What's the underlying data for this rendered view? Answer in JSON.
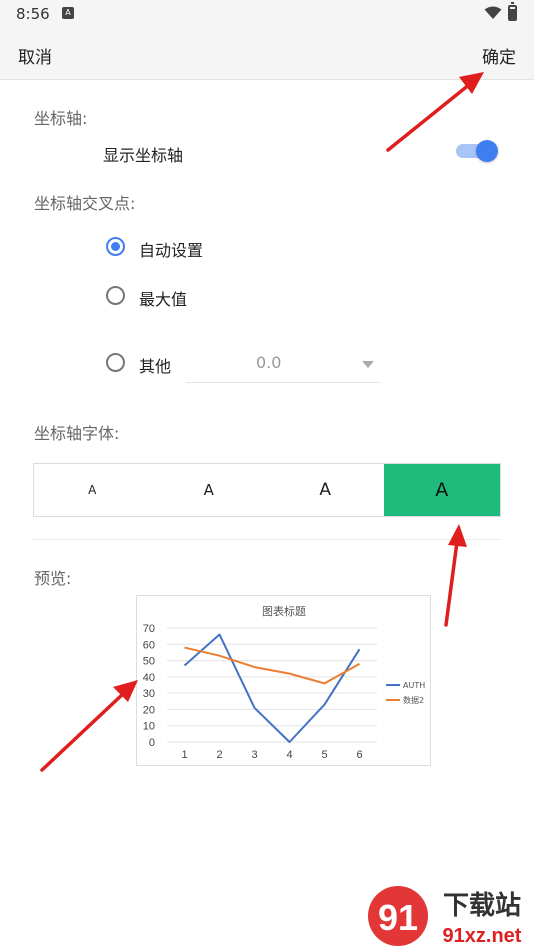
{
  "status_bar": {
    "time": "8:56",
    "notification_glyph": "A"
  },
  "top_bar": {
    "cancel_label": "取消",
    "confirm_label": "确定"
  },
  "axis": {
    "section_label": "坐标轴:",
    "show_axis_label": "显示坐标轴",
    "show_axis_on": true
  },
  "crossing": {
    "section_label": "坐标轴交叉点:",
    "options": [
      "自动设置",
      "最大值",
      "其他"
    ],
    "selected_index": 0,
    "other_value": "0.0"
  },
  "font": {
    "section_label": "坐标轴字体:",
    "options": [
      "A",
      "A",
      "A",
      "A"
    ],
    "selected_index": 3
  },
  "preview": {
    "section_label": "预览:"
  },
  "chart_data": {
    "type": "line",
    "title": "图表标题",
    "categories": [
      "1",
      "2",
      "3",
      "4",
      "5",
      "6"
    ],
    "ylim": [
      0,
      70
    ],
    "yticks": [
      "0",
      "10",
      "20",
      "30",
      "40",
      "50",
      "60",
      "70"
    ],
    "grid": true,
    "legend_position": "right",
    "series": [
      {
        "name": "AUTH",
        "values": [
          47,
          66,
          21,
          0,
          23,
          57
        ],
        "color": "#4472c4"
      },
      {
        "name": "数据2",
        "values": [
          58,
          53,
          46,
          42,
          36,
          48
        ],
        "color": "#ed7d31"
      }
    ]
  },
  "colors": {
    "accent_blue": "#3f7ef0",
    "selected_green": "#1fbb7d",
    "annotation_red": "#e01e1e"
  },
  "watermark": {
    "glyph": "91",
    "text_top": "下载站",
    "text_bottom": "91xz.net"
  }
}
